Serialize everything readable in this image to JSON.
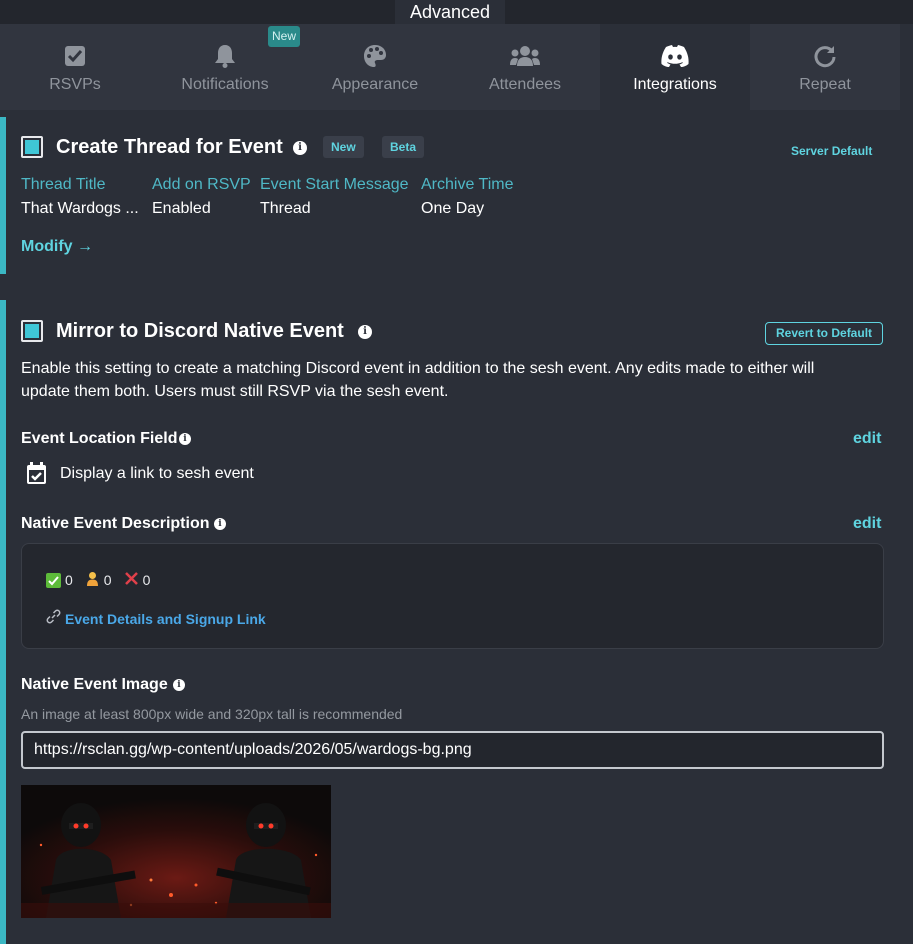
{
  "header": {
    "advanced_label": "Advanced"
  },
  "tabs": [
    {
      "label": "RSVPs",
      "icon": "checkbox-icon",
      "active": false
    },
    {
      "label": "Notifications",
      "icon": "bell-icon",
      "active": false,
      "badge": "New"
    },
    {
      "label": "Appearance",
      "icon": "palette-icon",
      "active": false
    },
    {
      "label": "Attendees",
      "icon": "users-icon",
      "active": false
    },
    {
      "label": "Integrations",
      "icon": "discord-icon",
      "active": true
    },
    {
      "label": "Repeat",
      "icon": "redo-icon",
      "active": false
    }
  ],
  "thread": {
    "title": "Create Thread for Event",
    "badges": [
      "New",
      "Beta"
    ],
    "server_default": "Server Default",
    "checked": true,
    "columns": [
      {
        "label": "Thread Title",
        "value": "That Wardogs ..."
      },
      {
        "label": "Add on RSVP",
        "value": "Enabled"
      },
      {
        "label": "Event Start Message",
        "value": "Thread"
      },
      {
        "label": "Archive Time",
        "value": "One Day"
      }
    ],
    "modify_label": "Modify",
    "modify_arrow": "→"
  },
  "mirror": {
    "title": "Mirror to Discord Native Event",
    "revert_label": "Revert to Default",
    "checked": true,
    "description": "Enable this setting to create a matching Discord event in addition to the sesh event. Any edits made to either will update them both. Users must still RSVP via the sesh event.",
    "location": {
      "label": "Event Location Field",
      "edit_label": "edit",
      "value": "Display a link to sesh event"
    },
    "native_description": {
      "label": "Native Event Description",
      "edit_label": "edit",
      "counts": [
        "0",
        "0",
        "0"
      ],
      "link_text": "Event Details and Signup Link"
    },
    "image": {
      "label": "Native Event Image",
      "hint": "An image at least 800px wide and 320px tall is recommended",
      "url": "https://rsclan.gg/wp-content/uploads/2026/05/wardogs-bg.png"
    }
  },
  "colors": {
    "accent": "#3bb8c4",
    "link": "#5fd4e0",
    "background": "#2b2f38",
    "tab_bar": "#31353f"
  }
}
